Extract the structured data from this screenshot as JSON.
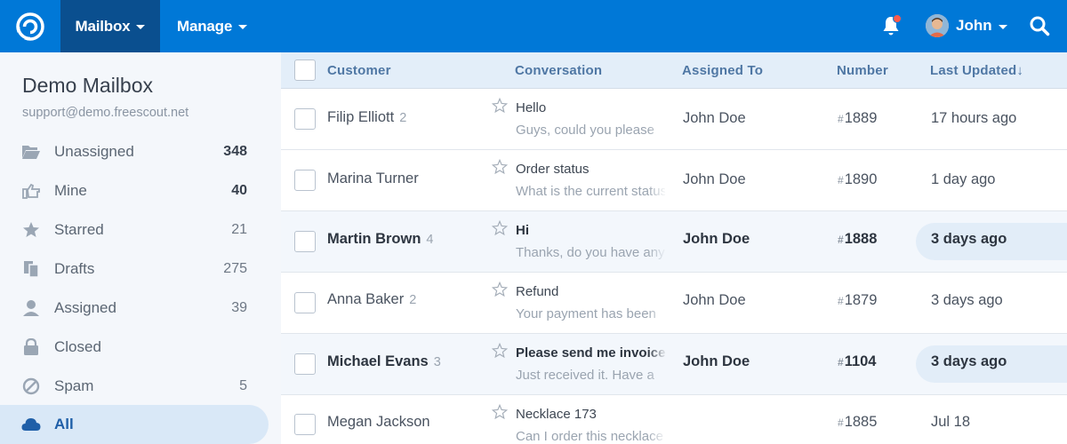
{
  "topbar": {
    "nav": [
      {
        "label": "Mailbox",
        "active": true
      },
      {
        "label": "Manage",
        "active": false
      }
    ],
    "user_name": "John",
    "notification_dot_color": "#ff5b4c",
    "bar_color": "#0078d7"
  },
  "sidebar": {
    "mailbox_name": "Demo Mailbox",
    "mailbox_email": "support@demo.freescout.net",
    "folders": [
      {
        "label": "Unassigned",
        "count": "348",
        "icon": "folder-open-icon",
        "bold": true
      },
      {
        "label": "Mine",
        "count": "40",
        "icon": "hand-point-icon",
        "bold": true
      },
      {
        "label": "Starred",
        "count": "21",
        "icon": "star-icon",
        "bold": false
      },
      {
        "label": "Drafts",
        "count": "275",
        "icon": "drafts-icon",
        "bold": false
      },
      {
        "label": "Assigned",
        "count": "39",
        "icon": "user-icon",
        "bold": false
      },
      {
        "label": "Closed",
        "count": "",
        "icon": "lock-icon",
        "bold": false
      },
      {
        "label": "Spam",
        "count": "5",
        "icon": "ban-icon",
        "bold": false
      },
      {
        "label": "All",
        "count": "",
        "icon": "cloud-icon",
        "bold": false,
        "active": true
      }
    ]
  },
  "table": {
    "headers": {
      "customer": "Customer",
      "conversation": "Conversation",
      "assigned": "Assigned To",
      "number": "Number",
      "updated": "Last Updated"
    },
    "sort_indicator": "↓",
    "rows": [
      {
        "customer": "Filip Elliott",
        "threads": "2",
        "subject": "Hello",
        "preview": "Guys, could you please",
        "assigned": "John Doe",
        "number": "1889",
        "updated": "17 hours ago",
        "unread": false
      },
      {
        "customer": "Marina Turner",
        "threads": "",
        "subject": "Order status",
        "preview": "What is the current status",
        "assigned": "John Doe",
        "number": "1890",
        "updated": "1 day ago",
        "unread": false
      },
      {
        "customer": "Martin Brown",
        "threads": "4",
        "subject": "Hi",
        "preview": "Thanks, do you have any",
        "assigned": "John Doe",
        "number": "1888",
        "updated": "3 days ago",
        "unread": true
      },
      {
        "customer": "Anna Baker",
        "threads": "2",
        "subject": "Refund",
        "preview": "Your payment has been",
        "assigned": "John Doe",
        "number": "1879",
        "updated": "3 days ago",
        "unread": false
      },
      {
        "customer": "Michael Evans",
        "threads": "3",
        "subject": "Please send me invoice",
        "preview": "Just received it. Have a",
        "assigned": "John Doe",
        "number": "1104",
        "updated": "3 days ago",
        "unread": true
      },
      {
        "customer": "Megan Jackson",
        "threads": "",
        "subject": "Necklace 173",
        "preview": "Can I order this necklace",
        "assigned": "",
        "number": "1885",
        "updated": "Jul 18",
        "unread": false
      }
    ]
  }
}
